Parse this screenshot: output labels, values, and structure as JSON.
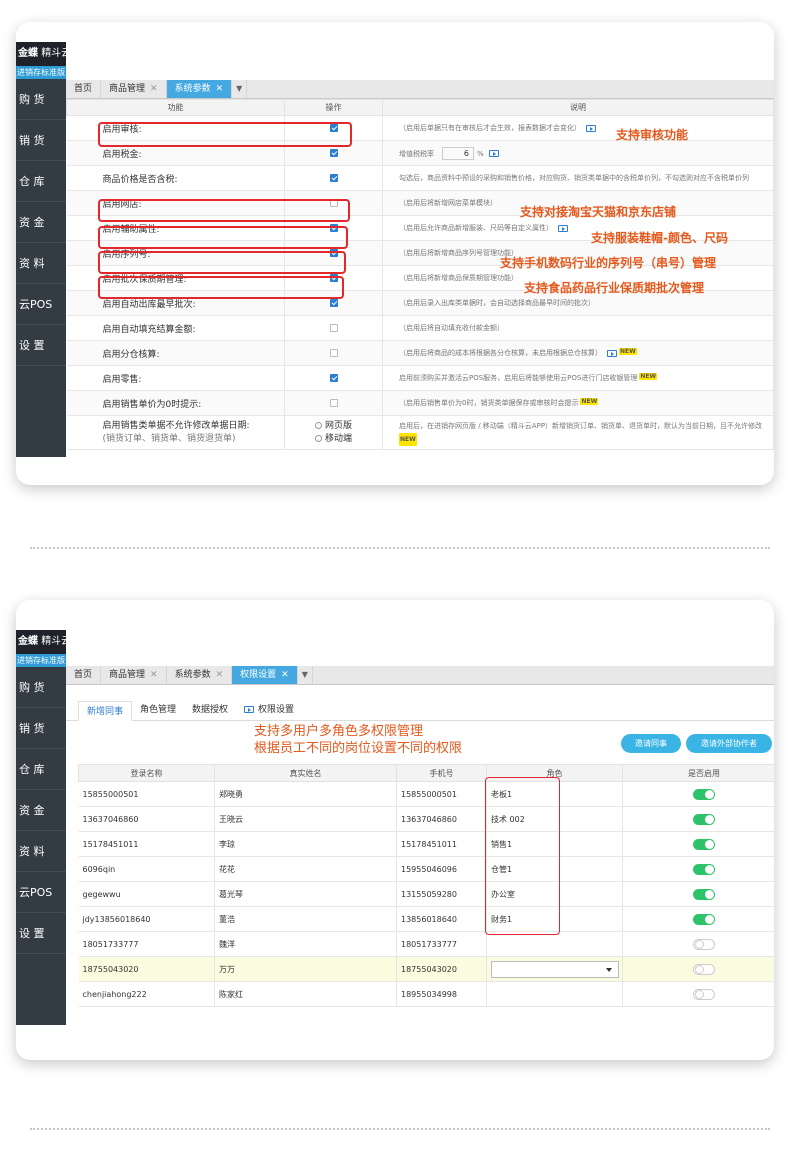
{
  "app": {
    "logo_brand": "金蝶",
    "logo_product": "精斗云",
    "edition": "进销存标准版"
  },
  "sidebar": {
    "items": [
      {
        "label": "购 货"
      },
      {
        "label": "销 货"
      },
      {
        "label": "仓 库"
      },
      {
        "label": "资 金"
      },
      {
        "label": "资 料"
      },
      {
        "label": "云POS"
      },
      {
        "label": "设 置"
      }
    ]
  },
  "screen1": {
    "tabs": [
      {
        "label": "首页",
        "closable": false
      },
      {
        "label": "商品管理",
        "closable": true
      },
      {
        "label": "系统参数",
        "closable": true,
        "active": true
      }
    ],
    "columns": {
      "function": "功能",
      "operation": "操作",
      "description": "说明"
    },
    "rows": [
      {
        "name": "启用审核:",
        "checked": true,
        "desc": "（启用后单据只有在审核后才会生效，报表数据才会变化）",
        "video": true,
        "new": false
      },
      {
        "name": "启用税金:",
        "checked": true,
        "desc": "增值税税率",
        "rate": "6",
        "rate_unit": "%",
        "video": true,
        "new": false
      },
      {
        "name": "商品价格是否含税:",
        "checked": true,
        "desc": "勾选后，商品资料中预设的采购和销售价格，对应购货、销货类单据中的含税单价列，不勾选则对应不含税单价列",
        "video": false,
        "new": false
      },
      {
        "name": "启用网店:",
        "checked": false,
        "desc": "（启用后将新增网店菜单模块）",
        "video": false,
        "new": false
      },
      {
        "name": "启用辅助属性:",
        "checked": true,
        "desc": "（启用后允许商品新增服装、尺码等自定义属性）",
        "video": true,
        "new": false
      },
      {
        "name": "启用序列号:",
        "checked": true,
        "desc": "（启用后将新增商品序列号管理功能）",
        "video": false,
        "new": false
      },
      {
        "name": "启用批次保质期管理:",
        "checked": true,
        "desc": "（启用后将新增商品保质期管理功能）",
        "video": false,
        "new": false
      },
      {
        "name": "启用自动出库最早批次:",
        "checked": true,
        "desc": "（启用后录入出库类单据时，会自动选择商品最早时间的批次）",
        "video": false,
        "new": false
      },
      {
        "name": "启用自动填充结算金额:",
        "checked": false,
        "desc": "（启用后将自动填充收付款金额）",
        "video": false,
        "new": false
      },
      {
        "name": "启用分仓核算:",
        "checked": false,
        "desc": "（启用后将商品的成本将根据各分仓核算，未启用根据总仓核算）",
        "video": true,
        "new": true
      },
      {
        "name": "启用零售:",
        "checked": true,
        "desc": "启用前须购买并激活云POS服务，启用后将能够使用云POS进行门店收银管理",
        "video": false,
        "new": true
      },
      {
        "name": "启用销售单价为0时提示:",
        "checked": false,
        "desc": "（启用后销售单价为0时，销货类单据保存或审核时会提示",
        "video": false,
        "new": true
      }
    ],
    "last_row": {
      "name_line1": "启用销售类单据不允许修改单据日期:",
      "name_line2": "(销货订单、销货单、销货退货单)",
      "option1": "网页版",
      "option2": "移动端",
      "desc": "启用后，在进销存网页版 / 移动端（精斗云APP）新增销货订单、销货单、退货单时，默认为当前日期，且不允许修改"
    },
    "new_badge": "NEW",
    "annotations": [
      "支持审核功能",
      "支持对接淘宝天猫和京东店铺",
      "支持服装鞋帽-颜色、尺码",
      "支持手机数码行业的序列号（串号）管理",
      "支持食品药品行业保质期批次管理"
    ]
  },
  "screen2": {
    "tabs": [
      {
        "label": "首页",
        "closable": false
      },
      {
        "label": "商品管理",
        "closable": true
      },
      {
        "label": "系统参数",
        "closable": true
      },
      {
        "label": "权限设置",
        "closable": true,
        "active": true
      }
    ],
    "subtabs": [
      "新增同事",
      "角色管理",
      "数据授权",
      "权限设置"
    ],
    "annotation_line1": "支持多用户多角色多权限管理",
    "annotation_line2": "根据员工不同的岗位设置不同的权限",
    "buttons": {
      "invite_colleague": "邀请同事",
      "invite_external": "邀请外部协作者"
    },
    "columns": {
      "login": "登录名称",
      "realname": "真实姓名",
      "phone": "手机号",
      "role": "角色",
      "enabled": "是否启用"
    },
    "users": [
      {
        "login": "15855000501",
        "name": "郑晓勇",
        "phone": "15855000501",
        "role": "老板1",
        "enabled": true
      },
      {
        "login": "13637046860",
        "name": "王晓云",
        "phone": "13637046860",
        "role": "技术 002",
        "enabled": true
      },
      {
        "login": "15178451011",
        "name": "李琼",
        "phone": "15178451011",
        "role": "销售1",
        "enabled": true
      },
      {
        "login": "6096qin",
        "name": "花花",
        "phone": "15955046096",
        "role": "仓管1",
        "enabled": true
      },
      {
        "login": "gegewwu",
        "name": "葛光琴",
        "phone": "13155059280",
        "role": "办公室",
        "enabled": true
      },
      {
        "login": "jdy13856018640",
        "name": "董浩",
        "phone": "13856018640",
        "role": "财务1",
        "enabled": true
      },
      {
        "login": "18051733777",
        "name": "魏洋",
        "phone": "18051733777",
        "role": "",
        "enabled": false
      },
      {
        "login": "18755043020",
        "name": "万万",
        "phone": "18755043020",
        "role": "",
        "enabled": false,
        "highlighted": true,
        "role_select": true
      },
      {
        "login": "chenjiahong222",
        "name": "陈家红",
        "phone": "18955034998",
        "role": "",
        "enabled": false
      }
    ]
  }
}
